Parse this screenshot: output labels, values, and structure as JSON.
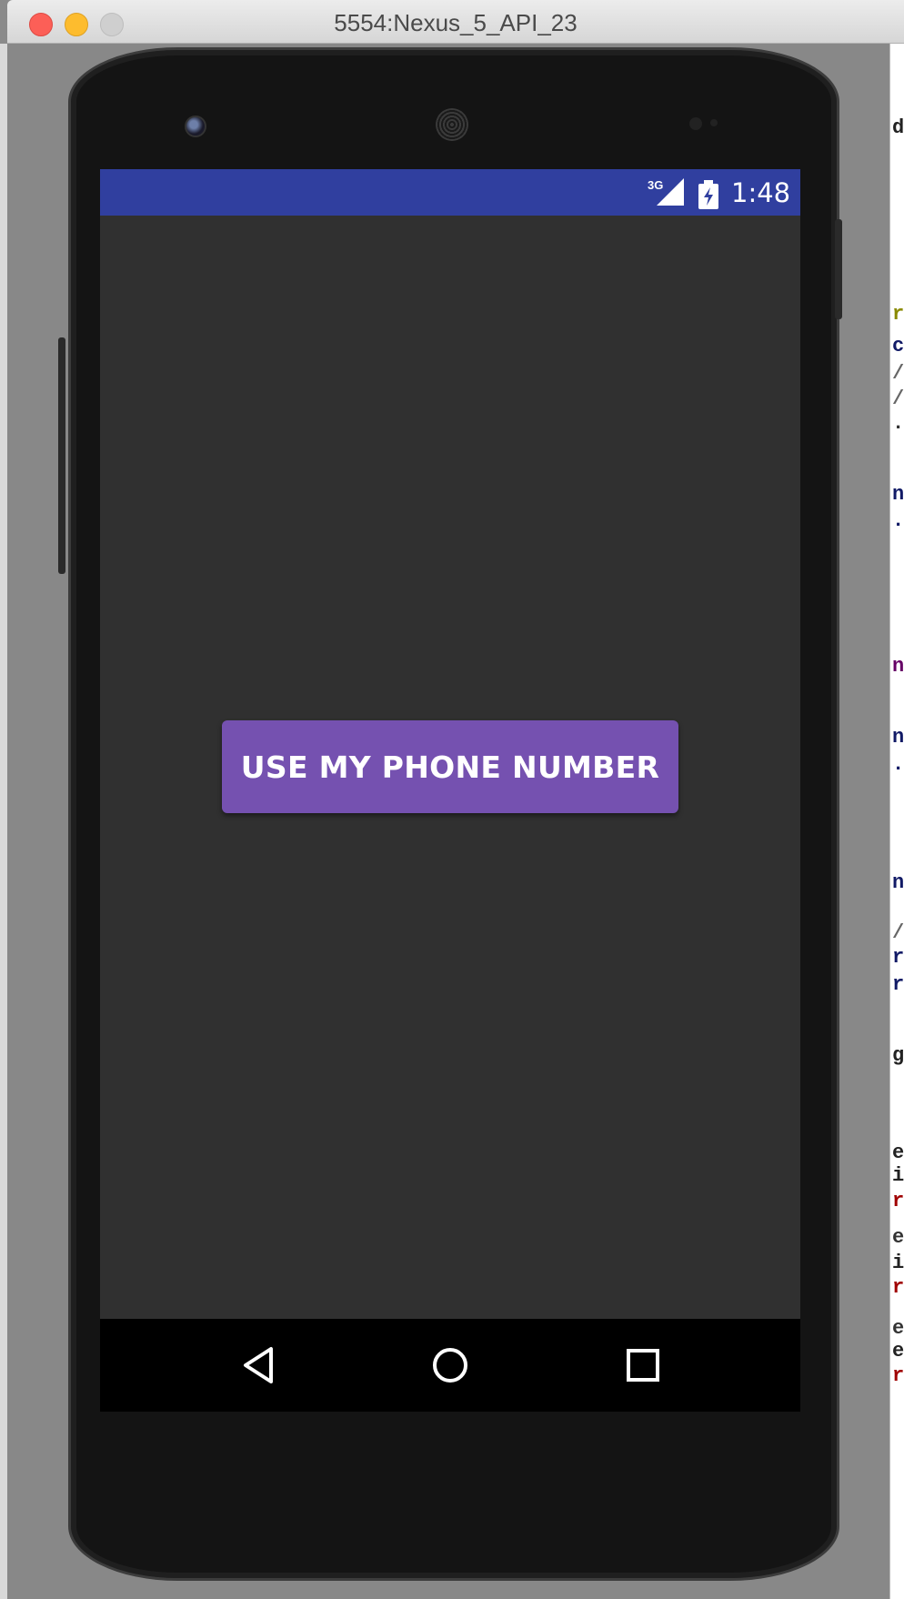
{
  "window": {
    "title": "5554:Nexus_5_API_23"
  },
  "status_bar": {
    "network": "3G",
    "time": "1:48",
    "color": "#303f9f"
  },
  "main": {
    "button_label": "USE MY PHONE NUMBER",
    "button_color": "#7551b0",
    "background_color": "#303030"
  },
  "navigation": {
    "back": "back-icon",
    "home": "home-icon",
    "recents": "recents-icon"
  },
  "editor_glimpse": {
    "lines": [
      "d",
      "r",
      "c",
      "/",
      "/",
      ".c",
      "nt",
      ".f",
      "nF",
      "nt",
      ".f",
      "nt",
      "/",
      "ri",
      "ri",
      "g",
      "er",
      "i",
      "rf",
      "e_",
      "i",
      "rf",
      "e_",
      "er",
      "rf"
    ]
  }
}
